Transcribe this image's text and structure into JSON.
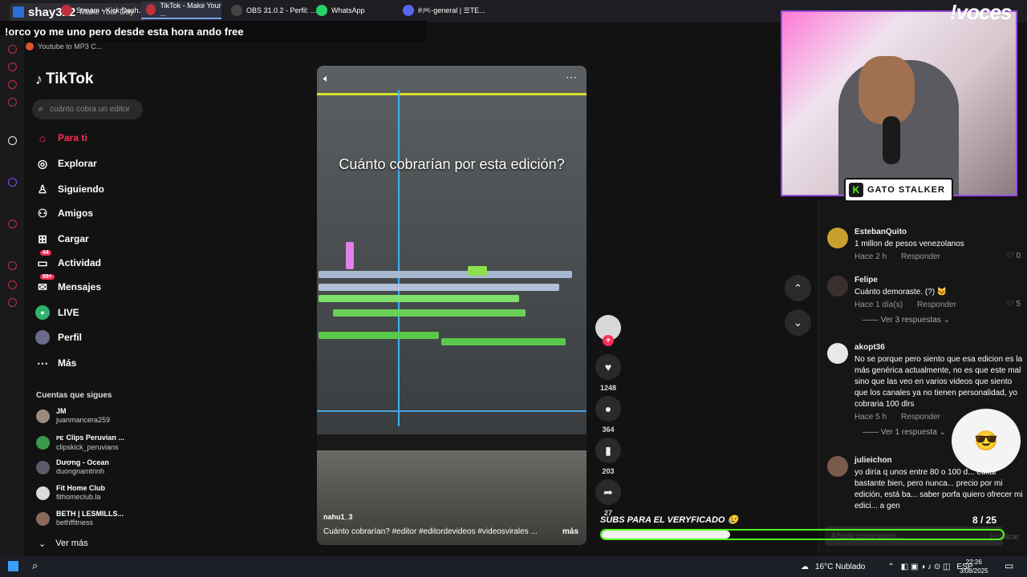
{
  "browser": {
    "streamer_name": "shay322",
    "tab_title": "Make Your Day",
    "new_tab": "+",
    "bookmark": "Youtube to MP3 C..."
  },
  "banner_text": "!orco yo me uno pero desde esta hora ando free",
  "tiktok": {
    "logo": "TikTok",
    "search_placeholder": "cuánto cobra un editor",
    "nav": [
      {
        "label": "Para ti",
        "icon": "home-icon",
        "active": true
      },
      {
        "label": "Explorar",
        "icon": "compass-icon"
      },
      {
        "label": "Siguiendo",
        "icon": "following-icon"
      },
      {
        "label": "Amigos",
        "icon": "friends-icon"
      },
      {
        "label": "Cargar",
        "icon": "upload-icon"
      },
      {
        "label": "Actividad",
        "icon": "activity-icon",
        "badge": "44"
      },
      {
        "label": "Mensajes",
        "icon": "messages-icon",
        "badge": "99+"
      },
      {
        "label": "LIVE",
        "icon": "live-icon"
      },
      {
        "label": "Perfil",
        "icon": "profile-icon"
      },
      {
        "label": "Más",
        "icon": "more-icon"
      }
    ],
    "following_title": "Cuentas que sigues",
    "following": [
      {
        "name": "JM",
        "handle": "juanmancera259"
      },
      {
        "name": "Clips Peruvian ...",
        "prefix": "PE",
        "handle": "clipskick_peruvians"
      },
      {
        "name": "Dương - Ocean",
        "handle": "duongnamtrinh"
      },
      {
        "name": "Fit Home Club",
        "handle": "fithomeclub.la"
      },
      {
        "name": "BETH | LESMILLS...",
        "handle": "bethffitness"
      }
    ],
    "see_more": "Ver más"
  },
  "video": {
    "caption": "Cuánto cobrarían por esta edición?",
    "author": "nahu1_3",
    "description": "Cuánto cobrarían? #editor #editordevideos #videosvirales ...",
    "more": "más",
    "likes": "1248",
    "comments": "364",
    "saves": "203",
    "shares": "27"
  },
  "comments": [
    {
      "user": "EstebanQuito",
      "text": "1 millon de pesos venezolanos",
      "time": "Hace 2 h",
      "reply": "Responder",
      "likes": "0"
    },
    {
      "user": "Felipe",
      "text": "Cuánto demoraste. (?) 🐱",
      "time": "Hace 1 día(s)",
      "reply": "Responder",
      "likes": "5",
      "replies": "Ver 3 respuestas"
    },
    {
      "user": "akopt36",
      "text": "No se porque pero siento que esa edicion es la más genérica actualmente, no es que este mal sino que las veo en varios videos que siento que los canales ya no tienen personalidad, yo cobraria 100 dlrs",
      "time": "Hace 5 h",
      "reply": "Responder",
      "likes": "",
      "replies": "Ver 1 respuesta"
    },
    {
      "user": "julieichon",
      "text": "yo diría q unos entre 80 o 100 d... editar bastante bien, pero nunca... precio por mi edición, está ba... saber porfa quiero ofrecer mi edici... a gen",
      "time": "",
      "reply": "",
      "likes": ""
    }
  ],
  "comment_box": {
    "placeholder": "Añadir comentario...",
    "post": "Publicar"
  },
  "overlay": {
    "voces": "!voces",
    "gato": "GATO STALKER",
    "subs_label": "SUBS PARA EL VERYFICADO 😢",
    "subs_count": "8 / 25",
    "subs_progress": 0.32
  },
  "taskbar": {
    "apps": [
      {
        "label": "Stream - Kick Dash...",
        "color": "#c0303c"
      },
      {
        "label": "TikTok - Make Your ...",
        "color": "#c0303c",
        "active": true
      },
      {
        "label": "OBS 31.0.2 - Perfil: ...",
        "color": "#444"
      },
      {
        "label": "WhatsApp",
        "color": "#25d366"
      },
      {
        "label": "#🎮-general | ☰TE...",
        "color": "#5865f2"
      }
    ],
    "weather": "16°C  Nublado",
    "lang": "ESP",
    "time": "22:26",
    "date": "3/08/2025"
  }
}
